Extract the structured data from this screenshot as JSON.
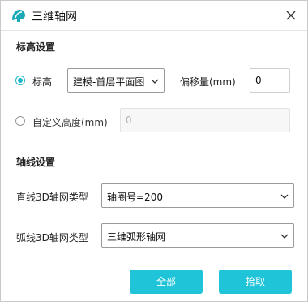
{
  "window": {
    "title": "三维轴网",
    "close_icon": "close-icon"
  },
  "elevation_section": {
    "title": "标高设置",
    "level_option": {
      "label": "标高",
      "selected": true
    },
    "level_select": {
      "value": "建模-首层平面图"
    },
    "offset_label": "偏移量(mm)",
    "offset_input": {
      "value": "0"
    },
    "custom_height_option": {
      "label": "自定义高度(mm)",
      "selected": false
    },
    "custom_height_input": {
      "value": "0"
    }
  },
  "axis_section": {
    "title": "轴线设置",
    "straight_label": "直线3D轴网类型",
    "straight_select": {
      "value": "轴圈号=200"
    },
    "arc_label": "弧线3D轴网类型",
    "arc_select": {
      "value": "三维弧形轴网"
    }
  },
  "buttons": {
    "all_label": "全部",
    "pick_label": "拾取"
  },
  "colors": {
    "accent": "#1fc4d9"
  }
}
